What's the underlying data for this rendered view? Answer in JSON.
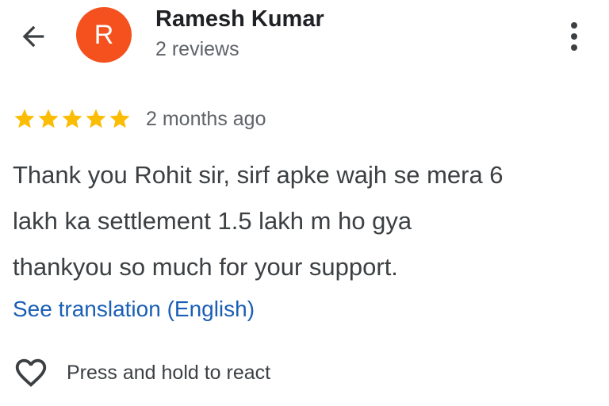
{
  "header": {
    "back_icon": "arrow-back-icon",
    "avatar_letter": "R",
    "avatar_color": "#f4511e",
    "reviewer_name": "Ramesh Kumar",
    "review_count": "2 reviews",
    "more_icon": "more-vert-icon"
  },
  "review": {
    "rating": 5,
    "rating_max": 5,
    "star_color": "#fbbc04",
    "date": "2 months ago",
    "text_lines": [
      "Thank you Rohit sir, sirf apke wajh se mera 6",
      "lakh ka settlement 1.5 lakh m ho gya",
      "thankyou so much for your support."
    ],
    "see_translation": "See translation (English)",
    "link_color": "#1a5fb4"
  },
  "reaction": {
    "icon": "heart-outline-icon",
    "label": "Press and hold to react"
  }
}
